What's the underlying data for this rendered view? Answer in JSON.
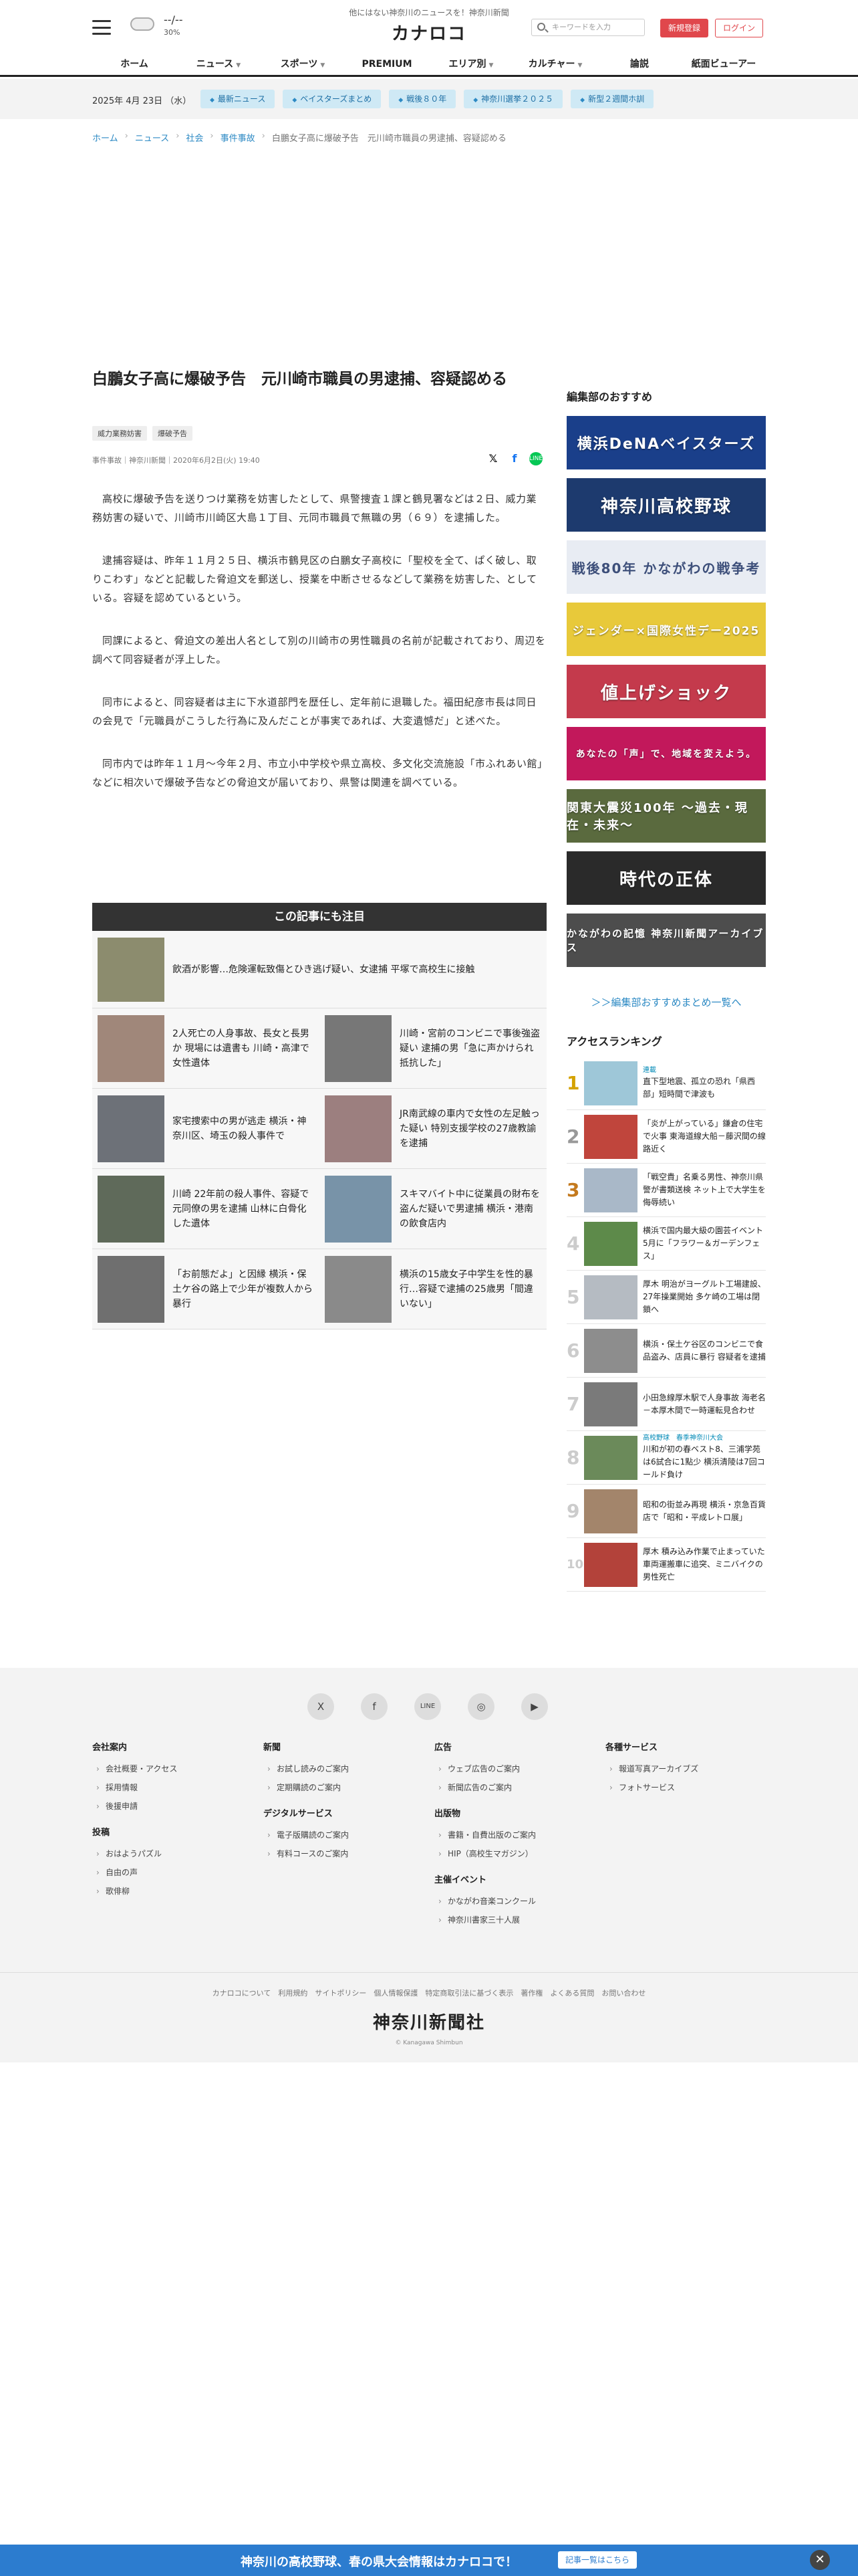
{
  "header": {
    "tagline": "他にはない神奈川のニュースを！神奈川新聞",
    "logo": "カナロコ",
    "weather_temp": "--/--",
    "weather_pct": "30%",
    "search_placeholder": "キーワードを入力",
    "register_label": "新規登録",
    "login_label": "ログイン",
    "nav": [
      "ホーム",
      "ニュース",
      "スポーツ",
      "PREMIUM",
      "エリア別",
      "カルチャー",
      "論説",
      "紙面ビューアー"
    ]
  },
  "subbar": {
    "date": "2025年 4月 23日 （水）",
    "pills": [
      "最新ニュース",
      "ベイスターズまとめ",
      "戦後８０年",
      "神奈川選挙２０２５",
      "新型２週間ホ訓"
    ]
  },
  "breadcrumb": [
    "ホーム",
    "ニュース",
    "社会",
    "事件事故",
    "白鵬女子高に爆破予告　元川崎市職員の男逮捕、容疑認める"
  ],
  "article": {
    "title": "白鵬女子高に爆破予告　元川崎市職員の男逮捕、容疑認める",
    "tags": [
      "威力業務妨害",
      "爆破予告"
    ],
    "meta": "事件事故｜神奈川新聞｜2020年6月2日(火) 19:40",
    "paragraphs": [
      "高校に爆破予告を送りつけ業務を妨害したとして、県警捜査１課と鶴見署などは２日、威力業務妨害の疑いで、川崎市川崎区大島１丁目、元同市職員で無職の男（６９）を逮捕した。",
      "逮捕容疑は、昨年１１月２５日、横浜市鶴見区の白鵬女子高校に「聖校を全て、ぱく破し、取りこわす」などと記載した脅迫文を郵送し、授業を中断させるなどして業務を妨害した、としている。容疑を認めているという。",
      "同課によると、脅迫文の差出人名として別の川崎市の男性職員の名前が記載されており、周辺を調べて同容疑者が浮上した。",
      "同市によると、同容疑者は主に下水道部門を歴任し、定年前に退職した。福田紀彦市長は同日の会見で「元職員がこうした行為に及んだことが事実であれば、大変遺憾だ」と述べた。",
      "同市内では昨年１１月～今年２月、市立小中学校や県立高校、多文化交流施設「市ふれあい館」などに相次いで爆破予告などの脅迫文が届いており、県警は関連を調べている。"
    ]
  },
  "related": {
    "heading": "この記事にも注目",
    "top": "飲酒が影響…危険運転致傷とひき逃げ疑い、女逮捕 平塚で高校生に接触",
    "items": [
      "2人死亡の人身事故、長女と長男か 現場には遺書も 川崎・高津で女性遺体",
      "川崎・宮前のコンビニで事後強盗疑い 逮捕の男「急に声かけられ抵抗した」",
      "家宅捜索中の男が逃走 横浜・神奈川区、埼玉の殺人事件で",
      "JR南武線の車内で女性の左足触った疑い 特別支援学校の27歳教諭を逮捕",
      "川崎 22年前の殺人事件、容疑で元同僚の男を逮捕 山林に白骨化した遺体",
      "スキマバイト中に従業員の財布を盗んだ疑いで男逮捕 横浜・港南の飲食店内",
      "「お前態だよ」と因縁 横浜・保土ケ谷の路上で少年が複数人から暴行",
      "横浜の15歳女子中学生を性的暴行…容疑で逮捕の25歳男「間違いない」"
    ]
  },
  "sidebar": {
    "heading": "編集部のおすすめ",
    "banners": [
      "横浜DeNAベイスターズ",
      "神奈川高校野球",
      "戦後80年 かながわの戦争考",
      "ジェンダー×国際女性デー2025",
      "値上げショック",
      "あなたの「声」で、地域を変えよう。",
      "関東大震災100年 〜過去・現在・未来〜",
      "時代の正体",
      "かながわの記憶 神奈川新聞アーカイブス"
    ],
    "banner_colors": [
      "#1a3f8a",
      "#1d3a6e",
      "#3d4f7a",
      "#e8c93a",
      "#c43a4c",
      "#c2185b",
      "#5a6a3e",
      "#2a2a2a",
      "#4d4d4d"
    ],
    "more": "＞＞編集部おすすめまとめ一覧へ",
    "ranking_heading": "アクセスランキング",
    "ranking": [
      {
        "no": "1",
        "cat": "連載",
        "text": "直下型地震、孤立の恐れ「県西部」短時間で津波も"
      },
      {
        "no": "2",
        "cat": "",
        "text": "「炎が上がっている」鎌倉の住宅で火事 東海道線大船－藤沢間の線路近く"
      },
      {
        "no": "3",
        "cat": "",
        "text": "「戦空貴」名乗る男性、神奈川県警が書類送検 ネット上で大学生を侮辱続い"
      },
      {
        "no": "4",
        "cat": "",
        "text": "横浜で国内最大級の園芸イベント 5月に「フラワー＆ガーデンフェス」"
      },
      {
        "no": "5",
        "cat": "",
        "text": "厚木 明治がヨーグルト工場建設、27年操業開始 多ケ崎の工場は閉鎖へ"
      },
      {
        "no": "6",
        "cat": "",
        "text": "横浜・保土ケ谷区のコンビニで食品盗み、店員に暴行 容疑者を逮捕"
      },
      {
        "no": "7",
        "cat": "",
        "text": "小田急線厚木駅で人身事故 海老名－本厚木間で一時運転見合わせ"
      },
      {
        "no": "8",
        "cat": "高校野球　春季神奈川大会",
        "text": "川和が初の春ベスト8、三浦学苑は6試合に1點少 横浜清陵は7回コールド負け"
      },
      {
        "no": "9",
        "cat": "",
        "text": "昭和の街並み再現 横浜・京急百貨店で「昭和・平成レトロ展」"
      },
      {
        "no": "10",
        "cat": "",
        "text": "厚木 積み込み作業で止まっていた車両運搬車に追突、ミニバイクの男性死亡"
      }
    ]
  },
  "footer": {
    "sns": [
      "X",
      "f",
      "LINE",
      "◎",
      "▶"
    ],
    "columns": [
      [
        {
          "title": "会社案内",
          "items": [
            "会社概要・アクセス",
            "採用情報",
            "後援申請"
          ]
        },
        {
          "title": "投稿",
          "items": [
            "おはようパズル",
            "自由の声",
            "歌俳柳"
          ]
        }
      ],
      [
        {
          "title": "新聞",
          "items": [
            "お試し読みのご案内",
            "定期購読のご案内"
          ]
        },
        {
          "title": "デジタルサービス",
          "items": [
            "電子版購読のご案内",
            "有料コースのご案内"
          ]
        }
      ],
      [
        {
          "title": "広告",
          "items": [
            "ウェブ広告のご案内",
            "新聞広告のご案内"
          ]
        },
        {
          "title": "出版物",
          "items": [
            "書籍・自費出版のご案内",
            "HIP（高校生マガジン）"
          ]
        },
        {
          "title": "主催イベント",
          "items": [
            "かながわ音楽コンクール",
            "神奈川書家三十人展"
          ]
        }
      ],
      [
        {
          "title": "各種サービス",
          "items": [
            "報道写真アーカイブズ",
            "フォトサービス"
          ]
        }
      ]
    ],
    "links": "カナロコについて　利用規約　サイトポリシー　個人情報保護　特定商取引法に基づく表示　著作権　よくある質問　お問い合わせ",
    "logo": "神奈川新聞社",
    "copyright": "© Kanagawa Shimbun"
  },
  "bottom_banner": {
    "text": "神奈川の高校野球、春の県大会情報はカナロコで！",
    "button": "記事一覧はこちら",
    "close": "✕"
  }
}
